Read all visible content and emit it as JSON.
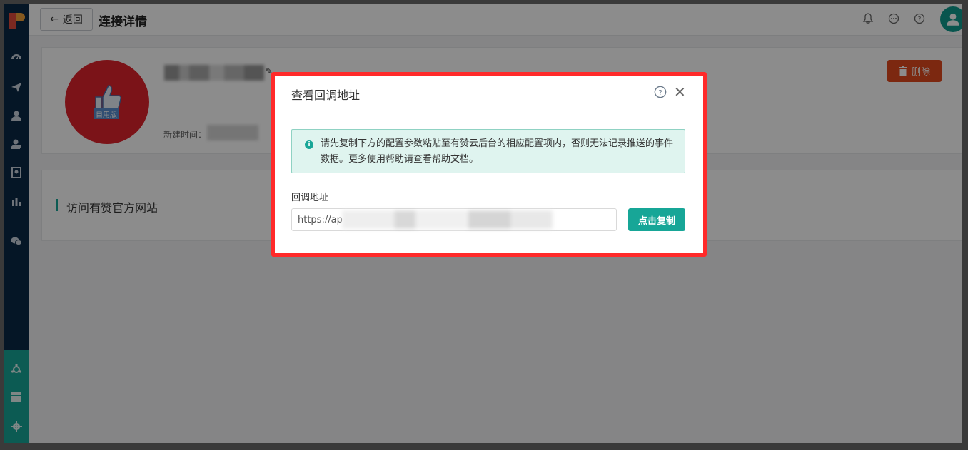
{
  "header": {
    "back_label": "返回",
    "title": "连接详情"
  },
  "card": {
    "thumb_tag": "自用版",
    "created_label": "新建时间：",
    "delete_label": "删除"
  },
  "section": {
    "title": "访问有赞官方网站"
  },
  "modal": {
    "title": "查看回调地址",
    "alert_text": "请先复制下方的配置参数粘贴至有赞云后台的相应配置项内，否则无法记录推送的事件数据。更多使用帮助请查看帮助文档。",
    "field_label": "回调地址",
    "url_value": "https://ap",
    "copy_label": "点击复制"
  },
  "colors": {
    "accent": "#17a697",
    "sidebar": "#0a2846",
    "danger": "#e24a1e",
    "highlight": "#ff2a2a"
  }
}
